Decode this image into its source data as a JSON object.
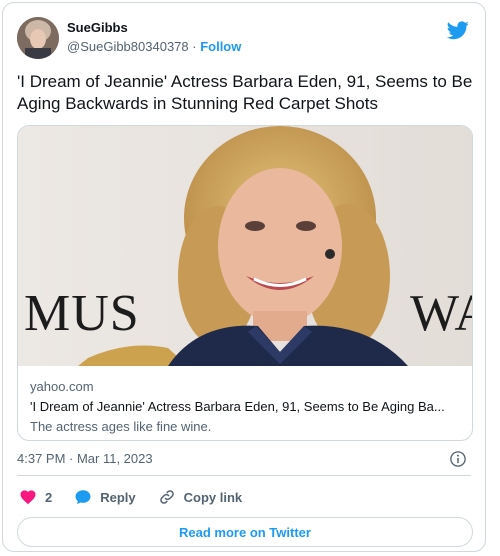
{
  "author": {
    "name": "SueGibbs",
    "handle": "@SueGibb80340378",
    "separator": " · ",
    "follow_label": "Follow"
  },
  "tweet": {
    "text": "'I Dream of Jeannie' Actress Barbara Eden, 91, Seems to Be Aging Backwards in Stunning Red Carpet Shots"
  },
  "link_card": {
    "backdrop_text_left": "MUS",
    "backdrop_text_right": "WA",
    "domain": "yahoo.com",
    "title": "'I Dream of Jeannie' Actress Barbara Eden, 91, Seems to Be Aging Ba...",
    "description": "The actress ages like fine wine."
  },
  "timestamp": "4:37 PM · Mar 11, 2023",
  "actions": {
    "like_count": "2",
    "reply_label": "Reply",
    "copy_link_label": "Copy link"
  },
  "read_more_label": "Read more on Twitter",
  "colors": {
    "brand_blue": "#1d9bf0",
    "like_red": "#f91880",
    "text_primary": "#0f1419",
    "text_secondary": "#536471",
    "border": "#cfd9de"
  },
  "icons": [
    "twitter-bird-icon",
    "info-icon",
    "heart-icon",
    "reply-bubble-icon",
    "link-icon"
  ]
}
